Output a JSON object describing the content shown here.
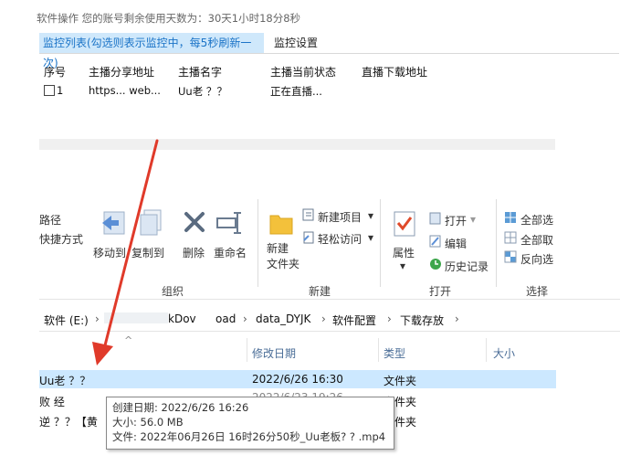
{
  "window": {
    "menu_text": "软件操作    您的账号剩余使用天数为：30天1小时18分8秒"
  },
  "tabs": [
    {
      "label": "监控列表(勾选则表示监控中，每5秒刷新一次)"
    },
    {
      "label": "监控设置"
    }
  ],
  "table": {
    "headers": [
      "序号",
      "主播分享地址",
      "主播名字",
      "主播当前状态",
      "直播下载地址"
    ],
    "rows": [
      {
        "index": "1",
        "share_url": "https... web...",
        "name": "Uu老 ？？",
        "status": "正在直播..."
      }
    ]
  },
  "ribbon": {
    "path_label": "路径",
    "shortcut_label": "快捷方式",
    "move_to": "移动到",
    "copy_to": "复制到",
    "delete": "删除",
    "rename": "重命名",
    "new_folder": "新建\n文件夹",
    "new_item": "新建项目",
    "easy_access": "轻松访问",
    "properties": "属性",
    "open": "打开",
    "edit": "编辑",
    "history": "历史记录",
    "select_all": "全部选",
    "select_none": "全部取",
    "invert_select": "反向选",
    "groups": [
      "组织",
      "新建",
      "打开",
      "选择"
    ]
  },
  "breadcrumb": {
    "items": [
      "软件 (E:)",
      "kDov",
      "oad",
      "data_DYJK",
      "软件配置",
      "下载存放"
    ]
  },
  "file_list": {
    "headers": [
      "修改日期",
      "类型",
      "大小"
    ],
    "rows": [
      {
        "name": "Uu老 ？？",
        "date": "2022/6/26 16:30",
        "type": "文件夹"
      },
      {
        "name": "败 经",
        "date": "2022/6/23 19:26",
        "type": "文件夹"
      },
      {
        "name": "逆 ？？【黄",
        "date": "",
        "type": "文件夹"
      }
    ]
  },
  "tooltip": {
    "created": "创建日期: 2022/6/26 16:26",
    "size": "大小: 56.0 MB",
    "files": "文件: 2022年06月26日 16时26分50秒_Uu老板? ? .mp4"
  },
  "colors": {
    "accent": "#1a73c7",
    "selected_row": "#cce8ff",
    "arrow": "#e03a2a"
  }
}
